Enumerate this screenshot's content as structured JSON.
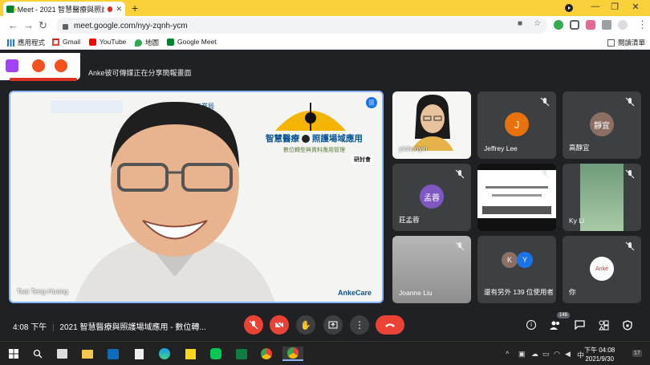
{
  "tab": {
    "title": "Meet - 2021 智慧醫療與照護..."
  },
  "omnibox": {
    "url": "meet.google.com/nyy-zqnh-ycm"
  },
  "bookmarks": [
    {
      "label": "應用程式"
    },
    {
      "label": "Gmail"
    },
    {
      "label": "YouTube"
    },
    {
      "label": "地圖"
    },
    {
      "label": "Google Meet"
    }
  ],
  "reading_list": "閱讀清單",
  "banner": {
    "text": "Anke彼可傳媒正在分享簡報畫面"
  },
  "main": {
    "presenter_name": "Tsai Teng-Huang",
    "slide_title_left": "智慧醫療",
    "slide_title_right": "照護場域應用",
    "slide_subtitle": "數位轉型與資料應用管理",
    "slide_tag": "研討會",
    "slide_brand": "AnkeCare",
    "slide_org": "工業局"
  },
  "participants": [
    {
      "name": "yichunyin",
      "initial": ""
    },
    {
      "name": "Jeffrey Lee",
      "initial": "J",
      "color": "#e8710a"
    },
    {
      "name": "高靜宜",
      "initial": "靜宜",
      "color": "#8d6e63"
    },
    {
      "name": "莊孟蓉",
      "initial": "孟蓉",
      "color": "#7e57c2"
    },
    {
      "name": "",
      "initial": ""
    },
    {
      "name": "Ky Li",
      "initial": ""
    },
    {
      "name": "Joanne Liu",
      "initial": ""
    },
    {
      "name": "還有另外 139 位使用者",
      "initial": "K",
      "initial2": "Y"
    },
    {
      "name": "你",
      "initial": "Anké"
    }
  ],
  "bottom": {
    "time": "4:08 下午",
    "meeting_title": "2021 智慧醫療與照護場域應用 - 數位轉...",
    "people_count": "148"
  },
  "taskbar": {
    "time": "下午 04:08",
    "date": "2021/9/30",
    "lang": "中",
    "notif": "17"
  }
}
